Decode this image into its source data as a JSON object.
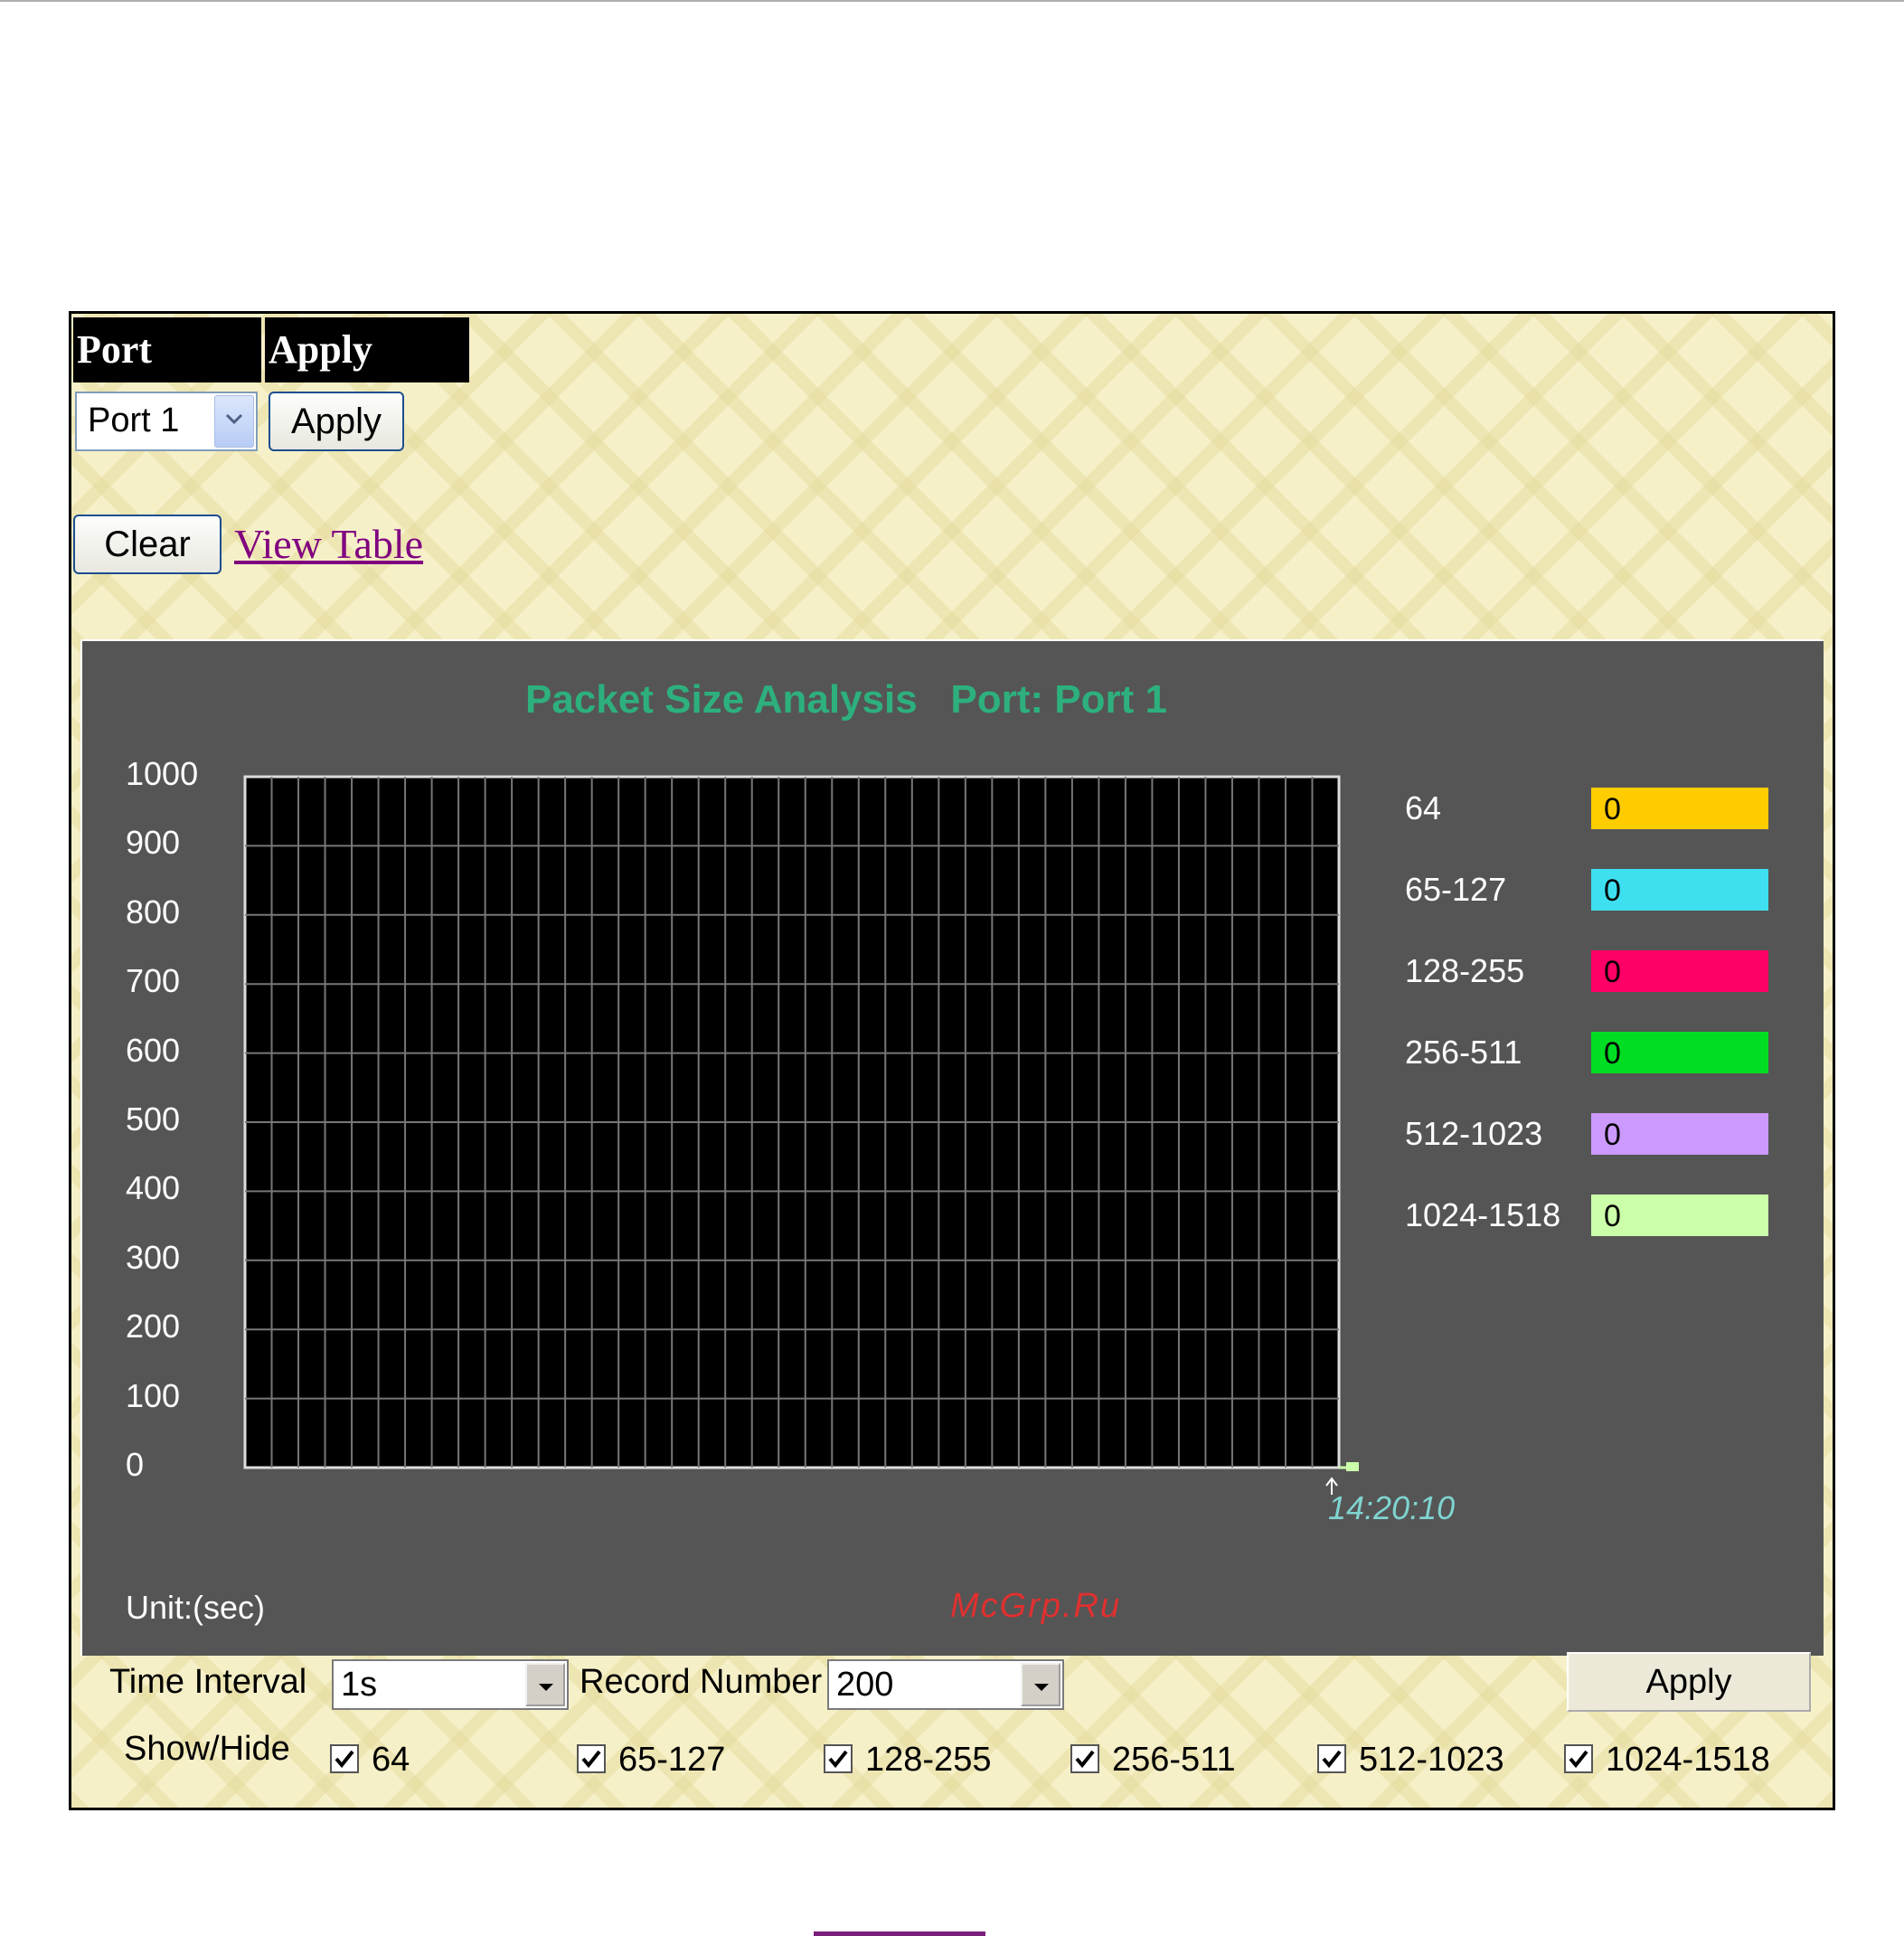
{
  "port_section": {
    "port_header": "Port",
    "apply_header": "Apply",
    "port_select_value": "Port 1",
    "apply_button": "Apply",
    "clear_button": "Clear",
    "view_table_link": "View Table"
  },
  "chart_data": {
    "type": "line",
    "title": "Packet Size Analysis",
    "subtitle": "Port: Port 1",
    "ylim": [
      0,
      1000
    ],
    "yticks": [
      "1000",
      "900",
      "800",
      "700",
      "600",
      "500",
      "400",
      "300",
      "200",
      "100",
      "0"
    ],
    "x_tick_label": "14:20:10",
    "x_unit_label": "Unit:(sec)",
    "grid": true,
    "legend_placement": "right",
    "series": [
      {
        "name": "64",
        "value": "0",
        "color": "#ffcc00"
      },
      {
        "name": "65-127",
        "value": "0",
        "color": "#3ee0f0"
      },
      {
        "name": "128-255",
        "value": "0",
        "color": "#ff0066"
      },
      {
        "name": "256-511",
        "value": "0",
        "color": "#00dd22"
      },
      {
        "name": "512-1023",
        "value": "0",
        "color": "#cc99ff"
      },
      {
        "name": "1024-1518",
        "value": "0",
        "color": "#ccffaa"
      }
    ]
  },
  "controls": {
    "time_interval_label": "Time Interval",
    "time_interval_value": "1s",
    "record_number_label": "Record Number",
    "record_number_value": "200",
    "apply_button": "Apply",
    "show_hide_label": "Show/Hide",
    "checkboxes": [
      {
        "label": "64",
        "checked": true
      },
      {
        "label": "65-127",
        "checked": true
      },
      {
        "label": "128-255",
        "checked": true
      },
      {
        "label": "256-511",
        "checked": true
      },
      {
        "label": "512-1023",
        "checked": true
      },
      {
        "label": "1024-1518",
        "checked": true
      }
    ]
  },
  "watermark": "McGrp.Ru"
}
